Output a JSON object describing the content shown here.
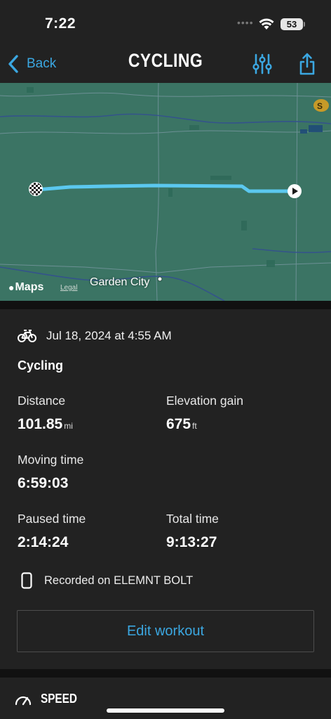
{
  "status_bar": {
    "time": "7:22",
    "signal_dots": "••••",
    "battery": "53"
  },
  "nav": {
    "back_label": "Back",
    "title": "CYCLING",
    "accent_color": "#3ba7e1",
    "icons": [
      "chevron-left-icon",
      "sliders-icon",
      "share-icon"
    ]
  },
  "map": {
    "city_label": "Garden City",
    "maps_brand": "Maps",
    "legal_link": "Legal",
    "route_color": "#5bc8ef",
    "start_marker": "checkered-flag-icon",
    "end_marker": "play-arrow-icon"
  },
  "workout": {
    "date": "Jul 18, 2024 at 4:55 AM",
    "type": "Cycling",
    "stats": {
      "distance": {
        "label": "Distance",
        "value": "101.85",
        "unit": "mi"
      },
      "elevation_gain": {
        "label": "Elevation gain",
        "value": "675",
        "unit": "ft"
      },
      "moving_time": {
        "label": "Moving time",
        "value": "6:59:03"
      },
      "paused_time": {
        "label": "Paused time",
        "value": "2:14:24"
      },
      "total_time": {
        "label": "Total time",
        "value": "9:13:27"
      }
    },
    "recorded_on": "Recorded on ELEMNT BOLT",
    "edit_button": "Edit workout"
  },
  "speed_section": {
    "title": "SPEED"
  }
}
